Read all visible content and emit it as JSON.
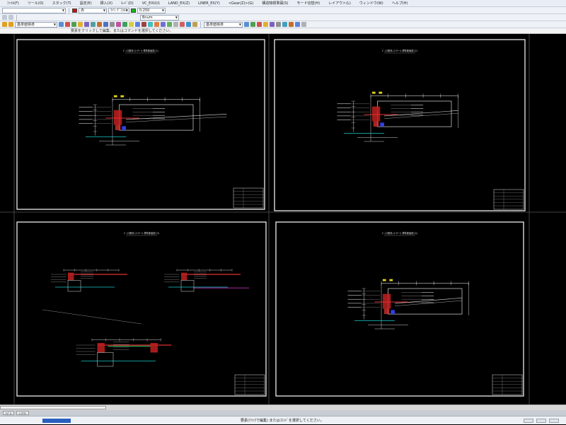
{
  "menu": [
    "ﾌｧｲﾙ(F)",
    "ツール(O)",
    "スタック(T)",
    "設定(E)",
    "挿入(X)",
    "ﾓｰﾄﾞ(D)",
    "VC_EXU(I)",
    "LAND_EX(Z)",
    "LINER_EX(Y)",
    "<Gear(Z)>(G)",
    "構造物標準図(S)",
    "モード切替(H)",
    "レイアウト(L)",
    "ウィンドウ(W)",
    "ヘルプ(H)"
  ],
  "toolbar": {
    "layer_combo": "",
    "color_combo": "赤",
    "ltype_combo": "ﾗｲﾝ ﾃﾞﾌｫﾙﾄ",
    "lw_combo": "0.250",
    "style_combo": "Bnum",
    "dim_combo": "基準値標準",
    "dim_combo2": "基準値標準",
    "colors": {
      "red": "#d01010",
      "green": "#18b818",
      "blue": "#2040d0"
    }
  },
  "prompt": "要素をクリックして編集、またはコマンドを選択してください。",
  "tabs": [
    "ﾓﾃﾞﾙ",
    "ﾚｲｱｳﾄ"
  ],
  "status": "要素(ｸﾘｯｸで編集) またはｺﾏﾝﾄﾞを選択してください。",
  "sheets": [
    {
      "title": "ﾎﾞｯｸｽ関係 (ｺﾝｸﾘｰﾄ) 標準断面図 (1)"
    },
    {
      "title": "ﾎﾞｯｸｽ関係 (ｺﾝｸﾘｰﾄ) 標準断面図 (2)"
    },
    {
      "title": "ﾎﾞｯｸｽ関係 (ｺﾝｸﾘｰﾄ) 標準断面図 (3)"
    },
    {
      "title": "ﾎﾞｯｸｽ関係 (ｺﾝｸﾘｰﾄ) 標準断面図 (4)"
    }
  ]
}
